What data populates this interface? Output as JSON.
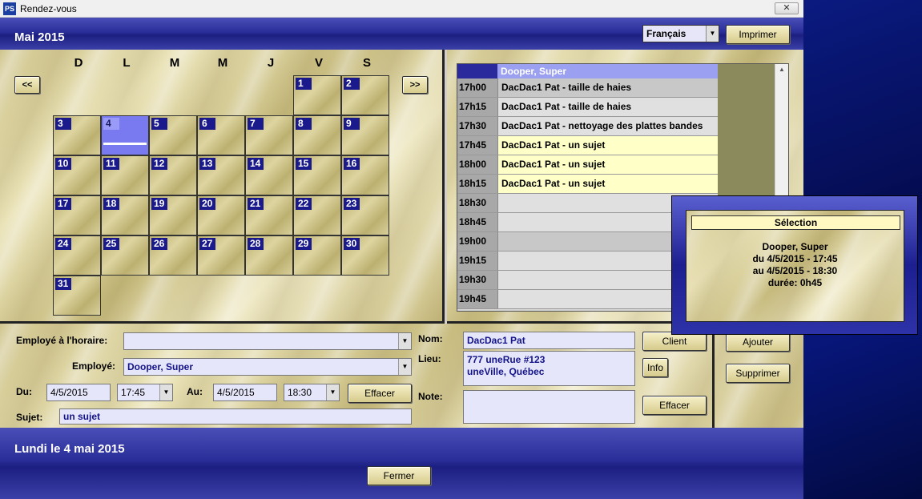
{
  "window": {
    "title": "Rendez-vous",
    "app_icon": "PS",
    "close_label": "✕"
  },
  "header": {
    "month_title": "Mai 2015",
    "language": "Français",
    "print_label": "Imprimer"
  },
  "calendar": {
    "weekdays": [
      "D",
      "L",
      "M",
      "M",
      "J",
      "V",
      "S"
    ],
    "prev_label": "<<",
    "next_label": ">>",
    "days": [
      "1",
      "2",
      "3",
      "4",
      "5",
      "6",
      "7",
      "8",
      "9",
      "10",
      "11",
      "12",
      "13",
      "14",
      "15",
      "16",
      "17",
      "18",
      "19",
      "20",
      "21",
      "22",
      "23",
      "24",
      "25",
      "26",
      "27",
      "28",
      "29",
      "30",
      "31"
    ],
    "selected_day": "4"
  },
  "schedule": {
    "employee": "Dooper, Super",
    "rows": [
      {
        "time": "17h00",
        "desc": "DacDac1 Pat - taille de haies"
      },
      {
        "time": "17h15",
        "desc": "DacDac1 Pat - taille de haies"
      },
      {
        "time": "17h30",
        "desc": "DacDac1 Pat - nettoyage des plattes bandes"
      },
      {
        "time": "17h45",
        "desc": "DacDac1 Pat - un sujet"
      },
      {
        "time": "18h00",
        "desc": "DacDac1 Pat - un sujet"
      },
      {
        "time": "18h15",
        "desc": "DacDac1 Pat - un sujet"
      },
      {
        "time": "18h30",
        "desc": ""
      },
      {
        "time": "18h45",
        "desc": ""
      },
      {
        "time": "19h00",
        "desc": ""
      },
      {
        "time": "19h15",
        "desc": ""
      },
      {
        "time": "19h30",
        "desc": ""
      },
      {
        "time": "19h45",
        "desc": ""
      }
    ]
  },
  "selection": {
    "title": "Sélection",
    "name": "Dooper, Super",
    "from": "du 4/5/2015 - 17:45",
    "to": "au 4/5/2015 - 18:30",
    "duration": "durée: 0h45"
  },
  "form": {
    "employee_schedule_label": "Employé à l'horaire:",
    "employee_schedule_value": "",
    "employee_label": "Employé:",
    "employee_value": "Dooper, Super",
    "from_label": "Du:",
    "from_date": "4/5/2015",
    "from_time": "17:45",
    "to_label": "Au:",
    "to_date": "4/5/2015",
    "to_time": "18:30",
    "clear_label": "Effacer",
    "subject_label": "Sujet:",
    "subject_value": "un sujet",
    "name_label": "Nom:",
    "name_value": "DacDac1 Pat",
    "place_label": "Lieu:",
    "place_line1": "777 uneRue #123",
    "place_line2": "uneVille, Québec",
    "note_label": "Note:",
    "note_value": "",
    "client_label": "Client",
    "info_label": "Info",
    "clear2_label": "Effacer",
    "add_label": "Ajouter",
    "delete_label": "Supprimer"
  },
  "footer": {
    "date_text": "Lundi le 4 mai 2015",
    "close_label": "Fermer"
  }
}
